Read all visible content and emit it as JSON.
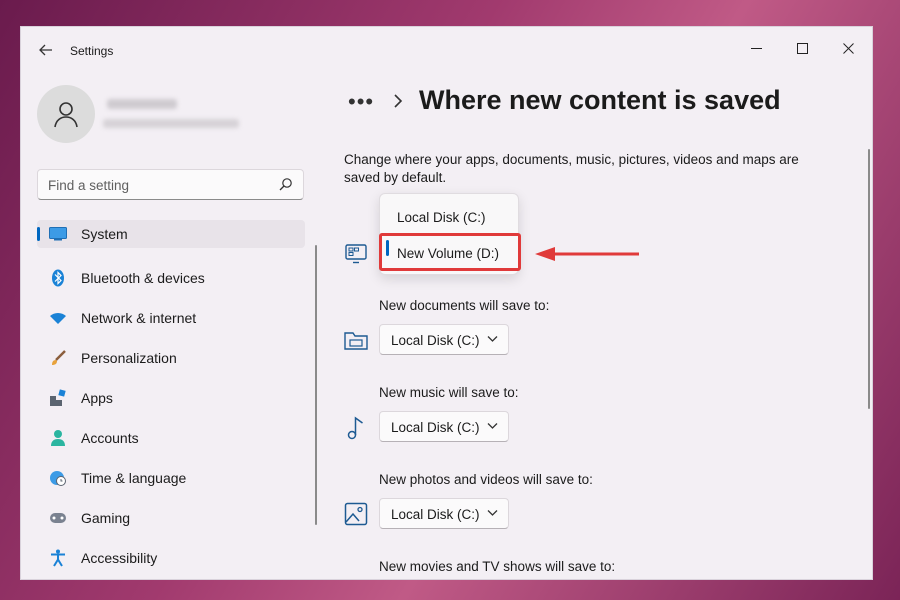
{
  "window": {
    "title": "Settings",
    "controls": [
      "minimize-icon",
      "maximize-icon",
      "close-icon"
    ]
  },
  "sidebar": {
    "search_placeholder": "Find a setting",
    "items": [
      {
        "label": "System",
        "icon": "system-icon",
        "active": true
      },
      {
        "label": "Bluetooth & devices",
        "icon": "bluetooth-icon"
      },
      {
        "label": "Network & internet",
        "icon": "wifi-icon"
      },
      {
        "label": "Personalization",
        "icon": "brush-icon"
      },
      {
        "label": "Apps",
        "icon": "apps-icon"
      },
      {
        "label": "Accounts",
        "icon": "accounts-icon"
      },
      {
        "label": "Time & language",
        "icon": "globe-clock-icon"
      },
      {
        "label": "Gaming",
        "icon": "gamepad-icon"
      },
      {
        "label": "Accessibility",
        "icon": "accessibility-icon"
      }
    ]
  },
  "main": {
    "breadcrumb_more": "•••",
    "title": "Where new content is saved",
    "description": "Change where your apps, documents, music, pictures, videos and maps are saved by default.",
    "open_dropdown": {
      "options": [
        "Local Disk (C:)",
        "New Volume (D:)"
      ],
      "selected": "New Volume (D:)"
    },
    "rows": [
      {
        "label": "New documents will save to:",
        "value": "Local Disk (C:)",
        "icon": "documents-folder-icon"
      },
      {
        "label": "New music will save to:",
        "value": "Local Disk (C:)",
        "icon": "music-note-icon"
      },
      {
        "label": "New photos and videos will save to:",
        "value": "Local Disk (C:)",
        "icon": "photo-icon"
      },
      {
        "label": "New movies and TV shows will save to:",
        "value": "",
        "icon": ""
      }
    ]
  },
  "colors": {
    "accent": "#0067c0",
    "annotation": "#e03a3a",
    "window_bg": "#f3eff4"
  }
}
